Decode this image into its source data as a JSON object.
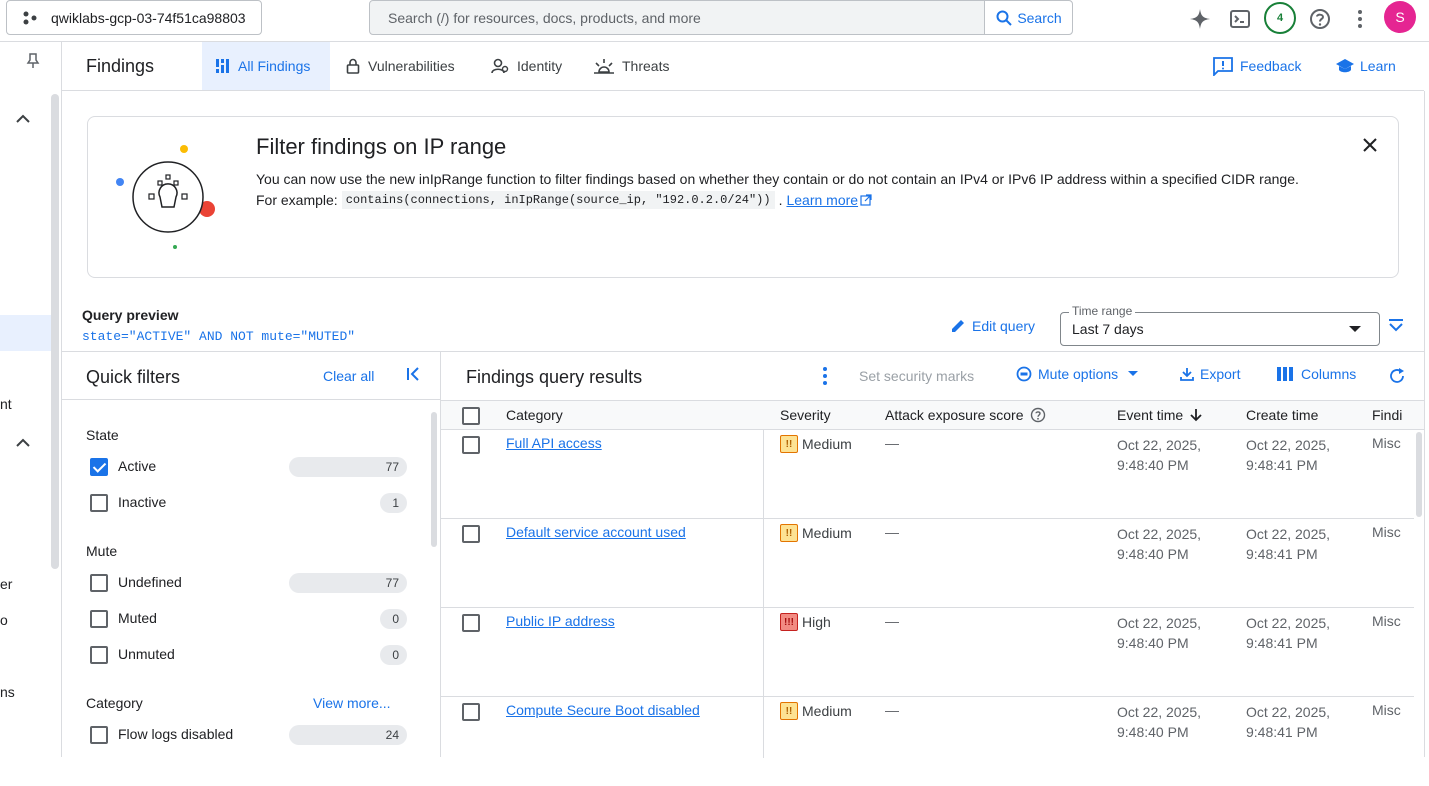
{
  "topbar": {
    "project": "qwiklabs-gcp-03-74f51ca98803",
    "search_placeholder": "Search (/) for resources, docs, products, and more",
    "search_button": "Search",
    "notifications_count": "4",
    "avatar_initial": "S"
  },
  "leftnav": {
    "fragments": [
      "nt",
      "er",
      "o",
      "ns"
    ]
  },
  "tabs": {
    "page_title": "Findings",
    "items": [
      {
        "label": "All Findings",
        "icon": "dashboard-icon",
        "active": true
      },
      {
        "label": "Vulnerabilities",
        "icon": "lock-icon",
        "active": false
      },
      {
        "label": "Identity",
        "icon": "identity-icon",
        "active": false
      },
      {
        "label": "Threats",
        "icon": "threat-icon",
        "active": false
      }
    ],
    "feedback": "Feedback",
    "learn": "Learn"
  },
  "banner": {
    "title": "Filter findings on IP range",
    "text1": "You can now use the new inIpRange function to filter findings based on whether they contain or do not contain an IPv4 or IPv6 IP address within a specified CIDR range.",
    "example_prefix": "For example:",
    "code": "contains(connections, inIpRange(source_ip, \"192.0.2.0/24\"))",
    "after_code": ".",
    "learn_more": "Learn more"
  },
  "query": {
    "label": "Query preview",
    "text": "state=\"ACTIVE\" AND NOT mute=\"MUTED\"",
    "edit": "Edit query",
    "time_range_label": "Time range",
    "time_range_value": "Last 7 days"
  },
  "quick_filters": {
    "title": "Quick filters",
    "clear_all": "Clear all",
    "sections": {
      "state": "State",
      "mute": "Mute",
      "category": "Category"
    },
    "state_items": [
      {
        "label": "Active",
        "count": "77",
        "checked": true
      },
      {
        "label": "Inactive",
        "count": "1",
        "checked": false
      }
    ],
    "mute_items": [
      {
        "label": "Undefined",
        "count": "77",
        "checked": false
      },
      {
        "label": "Muted",
        "count": "0",
        "checked": false
      },
      {
        "label": "Unmuted",
        "count": "0",
        "checked": false
      }
    ],
    "category_items": [
      {
        "label": "Flow logs disabled",
        "count": "24",
        "checked": false
      }
    ],
    "view_more": "View more..."
  },
  "results": {
    "title": "Findings query results",
    "set_marks": "Set security marks",
    "mute_options": "Mute options",
    "export": "Export",
    "columns": "Columns",
    "headers": {
      "category": "Category",
      "severity": "Severity",
      "attack": "Attack exposure score",
      "event_time": "Event time",
      "create_time": "Create time",
      "finding": "Findi"
    },
    "rows": [
      {
        "category": "Full API access",
        "severity": "Medium",
        "sev_level": "med",
        "attack": "—",
        "event_date": "Oct 22, 2025,",
        "event_time": "9:48:40 PM",
        "create_date": "Oct 22, 2025,",
        "create_time": "9:48:41 PM",
        "finding": "Misc"
      },
      {
        "category": "Default service account used",
        "severity": "Medium",
        "sev_level": "med",
        "attack": "—",
        "event_date": "Oct 22, 2025,",
        "event_time": "9:48:40 PM",
        "create_date": "Oct 22, 2025,",
        "create_time": "9:48:41 PM",
        "finding": "Misc"
      },
      {
        "category": "Public IP address",
        "severity": "High",
        "sev_level": "high",
        "attack": "—",
        "event_date": "Oct 22, 2025,",
        "event_time": "9:48:40 PM",
        "create_date": "Oct 22, 2025,",
        "create_time": "9:48:41 PM",
        "finding": "Misc"
      },
      {
        "category": "Compute Secure Boot disabled",
        "severity": "Medium",
        "sev_level": "med",
        "attack": "—",
        "event_date": "Oct 22, 2025,",
        "event_time": "9:48:40 PM",
        "create_date": "Oct 22, 2025,",
        "create_time": "9:48:41 PM",
        "finding": "Misc"
      }
    ]
  },
  "colors": {
    "accent": "#1a73e8",
    "active_tab_bg": "#e8f0fe",
    "avatar": "#e52592",
    "medium": "#fde293",
    "high": "#f28b82"
  }
}
